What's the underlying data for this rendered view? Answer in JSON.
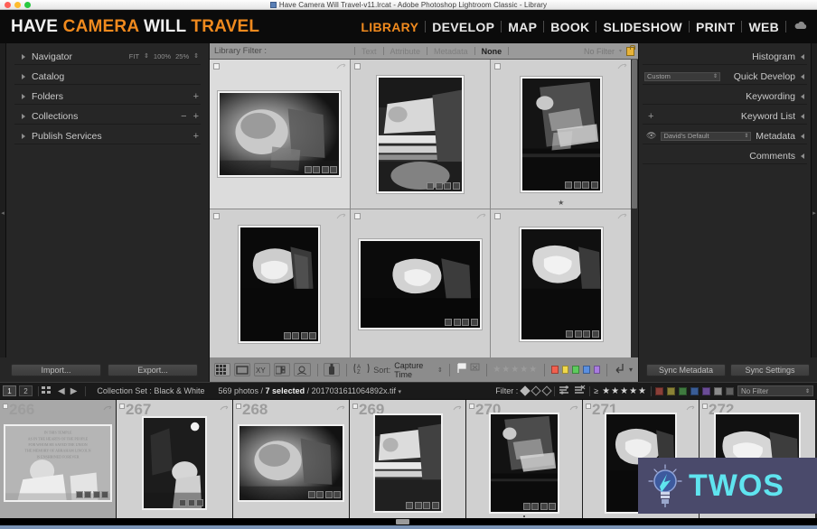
{
  "window": {
    "title": "Have Camera Will Travel-v11.lrcat - Adobe Photoshop Lightroom Classic - Library",
    "icon": "lrcat-document-icon"
  },
  "identity_plate": {
    "word1": "HAVE",
    "word2": "CAMERA",
    "word3": "WILL",
    "word4": "TRAVEL"
  },
  "modules": {
    "items": [
      {
        "label": "LIBRARY",
        "active": true
      },
      {
        "label": "DEVELOP",
        "active": false
      },
      {
        "label": "MAP",
        "active": false
      },
      {
        "label": "BOOK",
        "active": false
      },
      {
        "label": "SLIDESHOW",
        "active": false
      },
      {
        "label": "PRINT",
        "active": false
      },
      {
        "label": "WEB",
        "active": false
      }
    ],
    "cloud_icon": "cloud-sync-icon"
  },
  "left_panel": {
    "items": [
      {
        "label": "Navigator",
        "has_plus": false,
        "has_minus": false
      },
      {
        "label": "Catalog",
        "has_plus": false,
        "has_minus": false
      },
      {
        "label": "Folders",
        "has_plus": true,
        "has_minus": false
      },
      {
        "label": "Collections",
        "has_plus": true,
        "has_minus": true
      },
      {
        "label": "Publish Services",
        "has_plus": true,
        "has_minus": false
      }
    ],
    "navigator": {
      "fit_label": "FIT",
      "zoom_100": "100%",
      "zoom_25": "25%"
    },
    "import_label": "Import...",
    "export_label": "Export..."
  },
  "library_filter": {
    "title": "Library Filter :",
    "options": [
      {
        "label": "Text",
        "active": false
      },
      {
        "label": "Attribute",
        "active": false
      },
      {
        "label": "Metadata",
        "active": false
      },
      {
        "label": "None",
        "active": true
      }
    ],
    "preset": "No Filter",
    "lock_icon": "lock-icon"
  },
  "grid": {
    "cells": [
      {
        "index": 1,
        "selected": true,
        "caption": "lincoln-statue-head-closeup",
        "orientation": "landscape",
        "star": false
      },
      {
        "index": 2,
        "selected": false,
        "caption": "lincoln-seated-wide",
        "orientation": "portrait",
        "star": false
      },
      {
        "index": 3,
        "selected": false,
        "caption": "lincoln-dark-profile",
        "orientation": "portrait",
        "star": true
      },
      {
        "index": 4,
        "selected": false,
        "caption": "lincoln-dramatic-dark",
        "orientation": "portrait",
        "star": false
      },
      {
        "index": 5,
        "selected": false,
        "caption": "lincoln-head-dark-wide",
        "orientation": "landscape",
        "star": false
      },
      {
        "index": 6,
        "selected": false,
        "caption": "lincoln-bust-dark",
        "orientation": "portrait",
        "star": false
      }
    ],
    "badge_icons": [
      "keyword-tag-icon",
      "crop-icon",
      "metadata-icon",
      "develop-adjust-icon"
    ],
    "rotate_icon": "rotate-icon",
    "checkbox_icon": "pick-flag-checkbox"
  },
  "toolbar": {
    "view_modes": [
      {
        "name": "grid-view-icon",
        "active": true
      },
      {
        "name": "loupe-view-icon",
        "active": false
      },
      {
        "name": "compare-view-icon",
        "active": false
      },
      {
        "name": "survey-view-icon",
        "active": false
      },
      {
        "name": "people-view-icon",
        "active": false
      }
    ],
    "spray_icon": "spray-can-icon",
    "sort_icon": "sort-az-icon",
    "sort_label": "Sort:",
    "sort_value": "Capture Time",
    "flag_icon": "flag-icon",
    "reject_icon": "reject-flag-icon",
    "rating_stars": 5,
    "color_labels": [
      "#f1604f",
      "#f0d84a",
      "#5dcb5d",
      "#5a8fe0",
      "#a87be0"
    ],
    "rotate_left_icon": "rotate-left-icon",
    "toolbar_menu_icon": "chevron-down-icon"
  },
  "right_panel": {
    "items": [
      {
        "label": "Histogram",
        "left_control": "none"
      },
      {
        "label": "Quick Develop",
        "left_control": "combo",
        "combo_value": "Custom"
      },
      {
        "label": "Keywording",
        "left_control": "none"
      },
      {
        "label": "Keyword List",
        "left_control": "plus"
      },
      {
        "label": "Metadata",
        "left_control": "eye-combo",
        "combo_value": "David's Default"
      },
      {
        "label": "Comments",
        "left_control": "none"
      }
    ],
    "sync_metadata_label": "Sync Metadata",
    "sync_settings_label": "Sync Settings"
  },
  "filmstrip_bar": {
    "monitor1": "1",
    "monitor2": "2",
    "grid_icon": "grid-squares-icon",
    "back_icon": "arrow-left-icon",
    "forward_icon": "arrow-right-icon",
    "source": "Collection Set : Black & White",
    "photo_count": "569 photos /",
    "selected_count": "7 selected",
    "active_file": "/ 2017031611064892x.tif",
    "dropdown_icon": "chevron-down-icon",
    "filter_label": "Filter :",
    "flag_filters": [
      "flag-picked-icon",
      "flag-unflagged-icon",
      "flag-rejected-icon"
    ],
    "attribute_icons": [
      "master-photo-icon",
      "virtual-copy-icon"
    ],
    "rating_operator": "≥",
    "rating_stars": 5,
    "color_labels": [
      "#8a3f38",
      "#8a8236",
      "#3f7a3f",
      "#3a5d96",
      "#6a4c96",
      "#8c8c8c",
      "#5f5f5f"
    ],
    "filter_preset": "No Filter"
  },
  "filmstrip": {
    "cells": [
      {
        "number": "266",
        "caption": "lincoln-memorial-inscription",
        "selected": true
      },
      {
        "number": "267",
        "caption": "lincoln-dark-light-orb",
        "selected": false
      },
      {
        "number": "268",
        "caption": "lincoln-head-closeup",
        "selected": false
      },
      {
        "number": "269",
        "caption": "lincoln-seated-wide",
        "selected": false
      },
      {
        "number": "270",
        "caption": "lincoln-dark-profile",
        "selected": false
      },
      {
        "number": "271",
        "caption": "lincoln-dark-bust",
        "selected": false
      },
      {
        "number": "272",
        "caption": "lincoln-bright-bust",
        "selected": false
      }
    ]
  },
  "watermark": {
    "text": "TWOS",
    "icon": "lightbulb-icon",
    "background": "#4a4a6b",
    "text_color": "#5fe4ef"
  },
  "colors": {
    "accent_orange": "#f08a1e",
    "panel_bg": "#262626",
    "grid_bg": "#d0d0d0",
    "toolbar_bg": "#8c8c8c"
  }
}
